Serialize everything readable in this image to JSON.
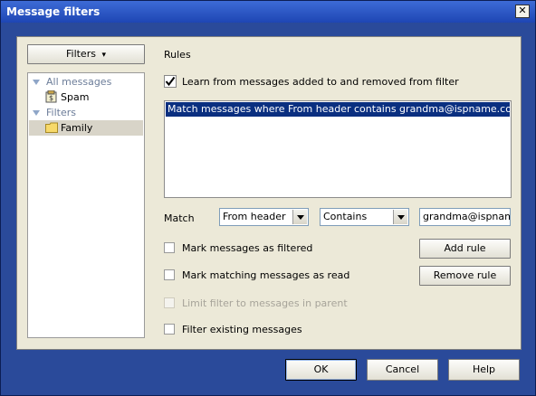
{
  "window": {
    "title": "Message filters",
    "close_glyph": "✕"
  },
  "sidebar": {
    "filters_button": "Filters",
    "dropdown_glyph": "▾",
    "tree": [
      {
        "label": "All messages",
        "kind": "group"
      },
      {
        "label": "Spam",
        "kind": "item",
        "icon": "spam-icon"
      },
      {
        "label": "Filters",
        "kind": "group"
      },
      {
        "label": "Family",
        "kind": "item",
        "icon": "folder-icon",
        "selected": true
      }
    ]
  },
  "rules": {
    "heading": "Rules",
    "learn_checkbox": {
      "label": "Learn from messages added to and removed from filter",
      "checked": true
    },
    "items": [
      "Match messages where From header contains grandma@ispname.com"
    ],
    "match_label": "Match",
    "field_select": "From header",
    "operator_select": "Contains",
    "value_input": "grandma@ispname.com",
    "add_rule": "Add rule",
    "remove_rule": "Remove rule",
    "options": [
      {
        "label": "Mark messages as filtered",
        "checked": false,
        "enabled": true
      },
      {
        "label": "Mark matching messages as read",
        "checked": false,
        "enabled": true
      },
      {
        "label": "Limit filter to messages in parent",
        "checked": false,
        "enabled": false
      },
      {
        "label": "Filter existing messages",
        "checked": false,
        "enabled": true
      }
    ]
  },
  "footer": {
    "ok": "OK",
    "cancel": "Cancel",
    "help": "Help"
  }
}
